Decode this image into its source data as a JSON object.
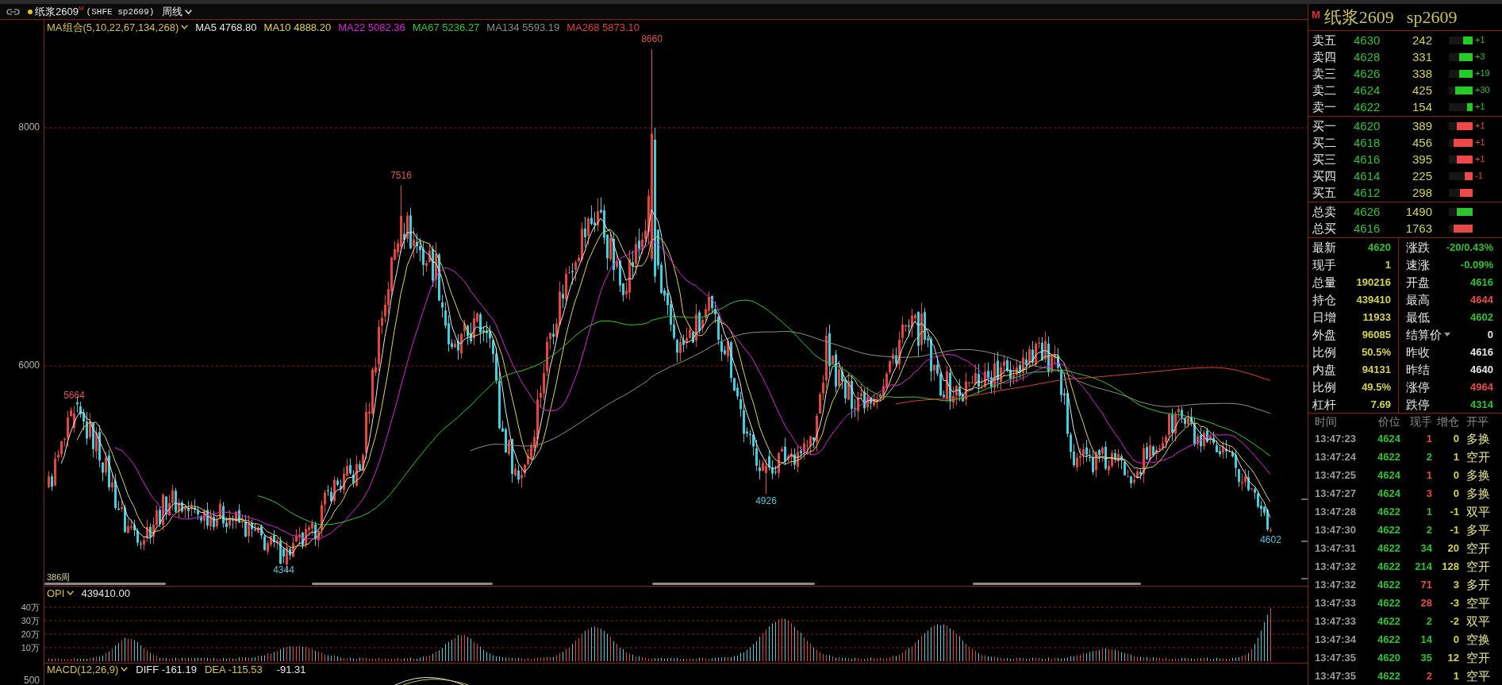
{
  "title_bar": {
    "symbol": "纸浆2609",
    "badge": "M",
    "exchange": "(SHFE sp2609)",
    "period": "周线"
  },
  "ma_legend": {
    "title": "MA组合(5,10,22,67,134,268)",
    "items": [
      {
        "label": "MA5",
        "value": "4768.80",
        "color": "#e6e6e6"
      },
      {
        "label": "MA10",
        "value": "4888.20",
        "color": "#e3d44a"
      },
      {
        "label": "MA22",
        "value": "5082.36",
        "color": "#e01ee0"
      },
      {
        "label": "MA67",
        "value": "5236.27",
        "color": "#2ec82e"
      },
      {
        "label": "MA134",
        "value": "5593.19",
        "color": "#8c8c8c"
      },
      {
        "label": "MA268",
        "value": "5873.10",
        "color": "#e23c3c"
      }
    ]
  },
  "price_chart": {
    "yticks": [
      "8000",
      "6000"
    ],
    "markers": [
      {
        "label": "8660",
        "kind": "high"
      },
      {
        "label": "7516",
        "kind": "high"
      },
      {
        "label": "5664",
        "kind": "high"
      },
      {
        "label": "4344",
        "kind": "low"
      },
      {
        "label": "4926",
        "kind": "low"
      },
      {
        "label": "4602",
        "kind": "low"
      }
    ],
    "bar_count": "386周"
  },
  "opi": {
    "title": "OPI",
    "value": "439410.00",
    "yticks": [
      "40万",
      "30万",
      "20万",
      "10万"
    ]
  },
  "macd": {
    "title": "MACD(12,26,9)",
    "diff_label": "DIFF",
    "diff": "-161.19",
    "dea_label": "DEA",
    "dea": "-115.53",
    "macd": "-91.31",
    "ytick": "500"
  },
  "quote": {
    "badge": "M",
    "name": "纸浆2609",
    "code": "sp2609"
  },
  "asks": [
    {
      "label": "卖五",
      "price": "4630",
      "volume": "242",
      "level": 0.4,
      "change": "+1"
    },
    {
      "label": "卖四",
      "price": "4628",
      "volume": "331",
      "level": 0.57,
      "change": "+3"
    },
    {
      "label": "卖三",
      "price": "4626",
      "volume": "338",
      "level": 0.57,
      "change": "+19"
    },
    {
      "label": "卖二",
      "price": "4624",
      "volume": "425",
      "level": 0.73,
      "change": "+30"
    },
    {
      "label": "卖一",
      "price": "4622",
      "volume": "154",
      "level": 0.23,
      "change": "+1"
    }
  ],
  "bids": [
    {
      "label": "买一",
      "price": "4620",
      "volume": "389",
      "level": 0.67,
      "change": "+1"
    },
    {
      "label": "买二",
      "price": "4618",
      "volume": "456",
      "level": 0.8,
      "change": "+1"
    },
    {
      "label": "买三",
      "price": "4616",
      "volume": "395",
      "level": 0.67,
      "change": "+1"
    },
    {
      "label": "买四",
      "price": "4614",
      "volume": "225",
      "level": 0.33,
      "change": "-1"
    },
    {
      "label": "买五",
      "price": "4612",
      "volume": "298",
      "level": 0.53
    }
  ],
  "totals": [
    {
      "label": "总卖",
      "price": "4626",
      "volume": "1490",
      "level": 0.67,
      "color": "#2ec22e"
    },
    {
      "label": "总买",
      "price": "4616",
      "volume": "1763",
      "level": 0.8,
      "color": "#e84848"
    }
  ],
  "stats": [
    {
      "left": {
        "label": "最新",
        "value": "4620",
        "color": "#2ec22e",
        "dropdown": false
      },
      "right": {
        "label": "涨跌",
        "value": "-20/0.43%",
        "color": "#2ec22e",
        "dropdown": false
      }
    },
    {
      "left": {
        "label": "现手",
        "value": "1",
        "color": "#d4d44a",
        "dropdown": false
      },
      "right": {
        "label": "速涨",
        "value": "-0.09%",
        "color": "#2ec22e",
        "dropdown": false
      }
    },
    {
      "left": {
        "label": "总量",
        "value": "190216",
        "color": "#d4d44a",
        "dropdown": false
      },
      "right": {
        "label": "开盘",
        "value": "4616",
        "color": "#2ec22e",
        "dropdown": false
      }
    },
    {
      "left": {
        "label": "持仓",
        "value": "439410",
        "color": "#d4d44a",
        "dropdown": false
      },
      "right": {
        "label": "最高",
        "value": "4644",
        "color": "#e84848",
        "dropdown": false
      }
    },
    {
      "left": {
        "label": "日增",
        "value": "11933",
        "color": "#d4d44a",
        "dropdown": false
      },
      "right": {
        "label": "最低",
        "value": "4602",
        "color": "#2ec22e",
        "dropdown": false
      }
    },
    {
      "left": {
        "label": "外盘",
        "value": "96085",
        "color": "#d4d44a",
        "dropdown": false
      },
      "right": {
        "label": "结算价",
        "value": "0",
        "color": "#e6e6e6",
        "dropdown": true
      }
    },
    {
      "left": {
        "label": "比例",
        "value": "50.5%",
        "color": "#d4d44a",
        "dropdown": false
      },
      "right": {
        "label": "昨收",
        "value": "4616",
        "color": "#e6e6e6",
        "dropdown": false
      }
    },
    {
      "left": {
        "label": "内盘",
        "value": "94131",
        "color": "#d4d44a",
        "dropdown": false
      },
      "right": {
        "label": "昨结",
        "value": "4640",
        "color": "#e6e6e6",
        "dropdown": false
      }
    },
    {
      "left": {
        "label": "比例",
        "value": "49.5%",
        "color": "#d4d44a",
        "dropdown": false
      },
      "right": {
        "label": "涨停",
        "value": "4964",
        "color": "#e84848",
        "dropdown": false
      }
    },
    {
      "left": {
        "label": "杠杆",
        "value": "7.69",
        "color": "#d4d44a",
        "dropdown": false
      },
      "right": {
        "label": "跌停",
        "value": "4314",
        "color": "#2ec22e",
        "dropdown": false
      }
    }
  ],
  "trades": {
    "columns": [
      "时间",
      "价位",
      "现手",
      "增仓",
      "开平"
    ],
    "rows": [
      {
        "time": "13:47:23",
        "price": "4624",
        "volume": "1",
        "color": "#e84848",
        "oi_change": "0",
        "type": "多换"
      },
      {
        "time": "13:47:24",
        "price": "4622",
        "volume": "2",
        "color": "#2ec22e",
        "oi_change": "1",
        "type": "空开"
      },
      {
        "time": "13:47:25",
        "price": "4624",
        "volume": "1",
        "color": "#e84848",
        "oi_change": "0",
        "type": "多换"
      },
      {
        "time": "13:47:27",
        "price": "4624",
        "volume": "3",
        "color": "#e84848",
        "oi_change": "0",
        "type": "多换"
      },
      {
        "time": "13:47:28",
        "price": "4622",
        "volume": "1",
        "color": "#2ec22e",
        "oi_change": "-1",
        "type": "双平"
      },
      {
        "time": "13:47:30",
        "price": "4622",
        "volume": "2",
        "color": "#2ec22e",
        "oi_change": "-1",
        "type": "多平"
      },
      {
        "time": "13:47:31",
        "price": "4622",
        "volume": "34",
        "color": "#2ec22e",
        "oi_change": "20",
        "type": "空开"
      },
      {
        "time": "13:47:32",
        "price": "4622",
        "volume": "214",
        "color": "#2ec22e",
        "oi_change": "128",
        "type": "空开"
      },
      {
        "time": "13:47:32",
        "price": "4622",
        "volume": "71",
        "color": "#e84848",
        "oi_change": "3",
        "type": "多开"
      },
      {
        "time": "13:47:33",
        "price": "4622",
        "volume": "28",
        "color": "#e84848",
        "oi_change": "-3",
        "type": "空平"
      },
      {
        "time": "13:47:33",
        "price": "4622",
        "volume": "2",
        "color": "#2ec22e",
        "oi_change": "-2",
        "type": "双平"
      },
      {
        "time": "13:47:34",
        "price": "4622",
        "volume": "14",
        "color": "#2ec22e",
        "oi_change": "0",
        "type": "空换"
      },
      {
        "time": "13:47:35",
        "price": "4620",
        "volume": "35",
        "color": "#2ec22e",
        "oi_change": "12",
        "type": "空开"
      },
      {
        "time": "13:47:35",
        "price": "4622",
        "volume": "2",
        "color": "#e84848",
        "oi_change": "1",
        "type": "空平"
      }
    ]
  }
}
